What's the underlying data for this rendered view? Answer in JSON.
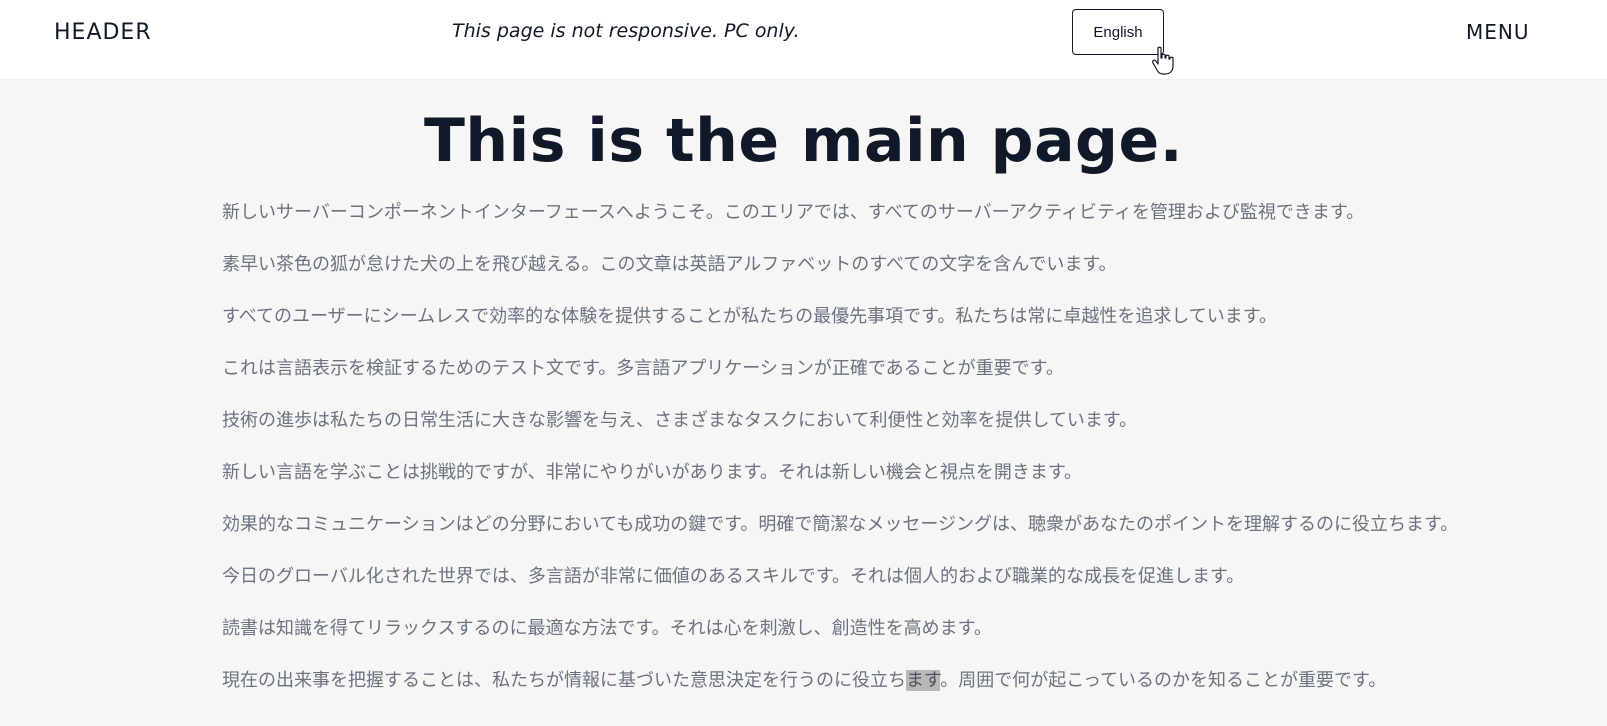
{
  "header": {
    "brand": "HEADER",
    "notice": "This page is not responsive. PC only.",
    "language_button": "English",
    "menu": "MENU"
  },
  "main": {
    "title": "This is the main page.",
    "paragraphs": [
      "新しいサーバーコンポーネントインターフェースへようこそ。このエリアでは、すべてのサーバーアクティビティを管理および監視できます。",
      "素早い茶色の狐が怠けた犬の上を飛び越える。この文章は英語アルファベットのすべての文字を含んでいます。",
      "すべてのユーザーにシームレスで効率的な体験を提供することが私たちの最優先事項です。私たちは常に卓越性を追求しています。",
      "これは言語表示を検証するためのテスト文です。多言語アプリケーションが正確であることが重要です。",
      "技術の進歩は私たちの日常生活に大きな影響を与え、さまざまなタスクにおいて利便性と効率を提供しています。",
      "新しい言語を学ぶことは挑戦的ですが、非常にやりがいがあります。それは新しい機会と視点を開きます。",
      "効果的なコミュニケーションはどの分野においても成功の鍵です。明確で簡潔なメッセージングは、聴衆があなたのポイントを理解するのに役立ちます。",
      "今日のグローバル化された世界では、多言語が非常に価値のあるスキルです。それは個人的および職業的な成長を促進します。",
      "読書は知識を得てリラックスするのに最適な方法です。それは心を刺激し、創造性を高めます。"
    ],
    "last_paragraph": {
      "before": "現在の出来事を把握することは、私たちが情報に基づいた意思決定を行うのに役立ち",
      "highlight": "ます",
      "after": "。周囲で何が起こっているのかを知ることが重要です。"
    }
  }
}
